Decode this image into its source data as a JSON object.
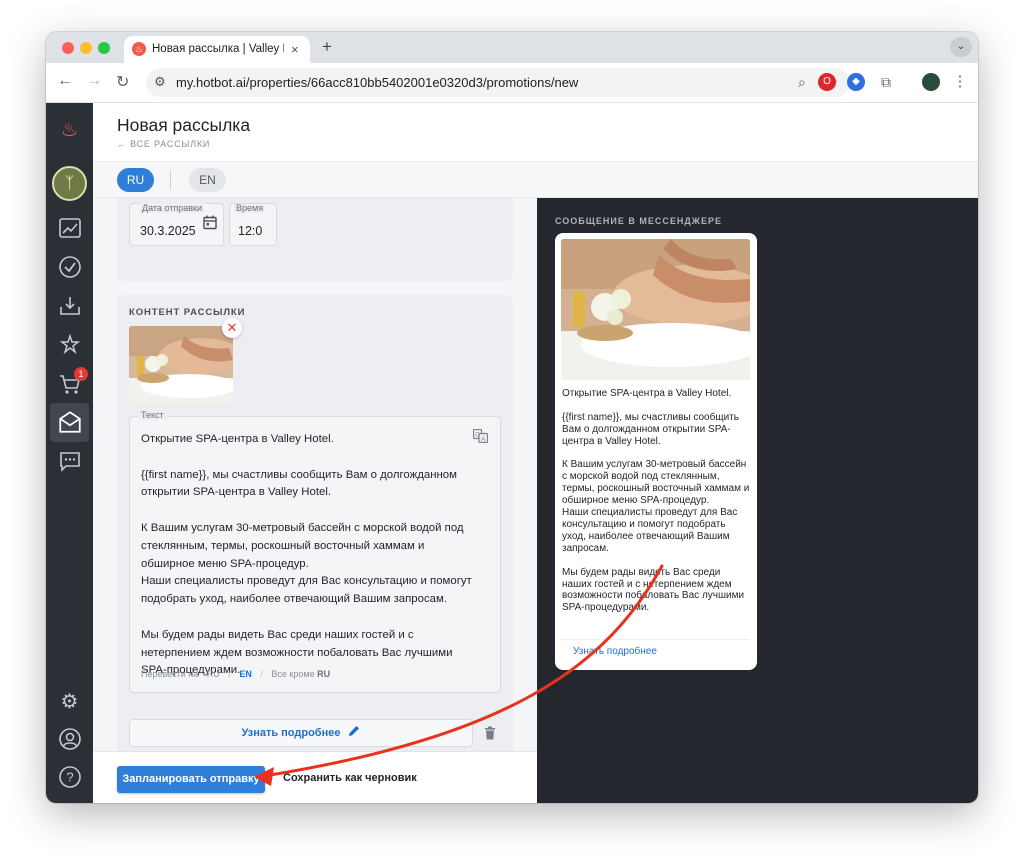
{
  "browser": {
    "tab_title": "Новая рассылка | Valley Hotel",
    "url": "my.hotbot.ai/properties/66acc810bb5402001e0320d3/promotions/new",
    "new_tab_symbol": "+",
    "tab_close_symbol": "×"
  },
  "header": {
    "title": "Новая рассылка",
    "back_link": "← ВСЕ РАССЫЛКИ"
  },
  "sidebar": {
    "cart_badge": "1",
    "items": [
      "logo-icon",
      "avatar",
      "analytics-icon",
      "check-icon",
      "inbox-icon",
      "star-icon",
      "cart-icon",
      "mail-icon",
      "chat-icon",
      "settings-icon",
      "account-icon",
      "help-icon"
    ]
  },
  "languages": [
    "RU",
    "EN"
  ],
  "schedule": {
    "date_label": "Дата отправки",
    "date_value": "30.3.2025",
    "time_label": "Время",
    "time_value": "12:0"
  },
  "content": {
    "section_title": "КОНТЕНТ РАССЫЛКИ",
    "text_label": "Текст",
    "text": "Открытие SPA-центра в Valley Hotel.\n\n{{first name}}, мы счастливы сообщить Вам о долгожданном открытии SPA-центра в Valley Hotel.\n\nК Вашим услугам 30-метровый бассейн с морской водой под стеклянным, термы, роскошный восточный хаммам и обширное меню SPA-процедур.\nНаши специалисты проведут для Вас консультацию и помогут подобрать уход, наиболее отвечающий Вашим запросам.\n\nМы будем рады видеть Вас среди наших гостей и с нетерпением ждем возможности побаловать Вас лучшими SPA-процедурами.",
    "translate_prefix": "Перевести на",
    "translate_ru": "RU",
    "translate_en": "EN",
    "translate_all": "Все кроме",
    "translate_all_lang": "RU",
    "more_button": "Узнать подробнее"
  },
  "footer": {
    "schedule_button": "Запланировать отправку",
    "draft_button": "Сохранить как черновик"
  },
  "preview": {
    "title": "СООБЩЕНИЕ В МЕССЕНДЖЕРЕ",
    "text": "Открытие SPA-центра в Valley Hotel.\n\n{{first name}}, мы счастливы сообщить Вам о долгожданном открытии SPA-центра в Valley Hotel.\n\nК Вашим услугам 30-метровый бассейн с морской водой под стеклянным, термы, роскошный восточный хаммам и обширное меню SPA-процедур.\nНаши специалисты проведут для Вас консультацию и помогут подобрать уход, наиболее отвечающий Вашим запросам.\n\nМы будем рады видеть Вас среди наших гостей и с нетерпением ждем возможности побаловать Вас лучшими SPA-процедурами.",
    "button": "Узнать подробнее"
  },
  "colors": {
    "accent": "#2f7fd8",
    "sidebar": "#2b2f36",
    "preview_bg": "#24282e",
    "annotation_arrow": "#e8321e"
  }
}
